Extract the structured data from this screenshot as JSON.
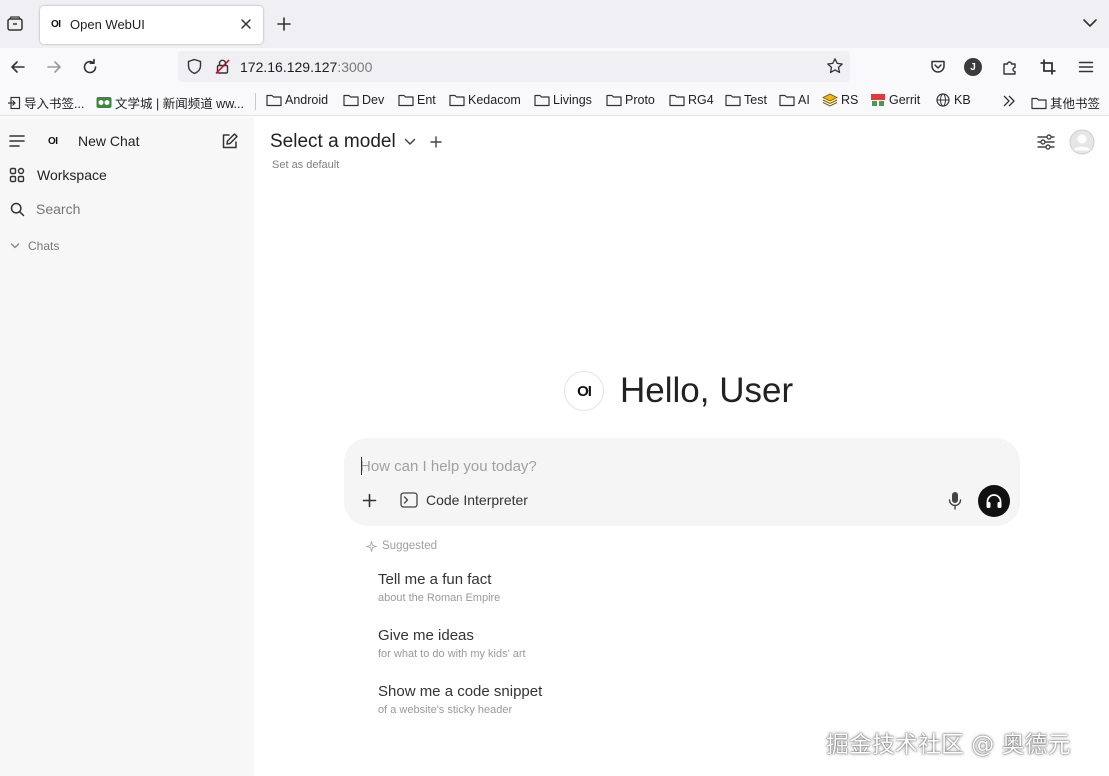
{
  "browser": {
    "tab_favicon": "OI",
    "tab_title": "Open WebUI",
    "url_host": "172.16.129.127",
    "url_port": ":3000",
    "profile_initial": "J",
    "bookmarks": [
      {
        "label": "导入书签..."
      },
      {
        "label": "文学城 | 新闻频道 ww..."
      },
      {
        "label": "Android"
      },
      {
        "label": "Dev"
      },
      {
        "label": "Ent"
      },
      {
        "label": "Kedacom"
      },
      {
        "label": "Livings"
      },
      {
        "label": "Proto"
      },
      {
        "label": "RG4"
      },
      {
        "label": "Test"
      },
      {
        "label": "AI"
      },
      {
        "label": "RS"
      },
      {
        "label": "Gerrit"
      },
      {
        "label": "KB"
      },
      {
        "label": "其他书签"
      }
    ]
  },
  "sidebar": {
    "logo": "OI",
    "new_chat": "New Chat",
    "workspace": "Workspace",
    "search_placeholder": "Search",
    "chats": "Chats"
  },
  "header": {
    "model_select": "Select a model",
    "set_default": "Set as default"
  },
  "hero": {
    "logo": "OI",
    "greeting": "Hello, User"
  },
  "composer": {
    "placeholder": "How can I help you today?",
    "value": "",
    "code_interpreter": "Code Interpreter"
  },
  "suggestions": {
    "heading": "Suggested",
    "items": [
      {
        "title": "Tell me a fun fact",
        "subtitle": "about the Roman Empire"
      },
      {
        "title": "Give me ideas",
        "subtitle": "for what to do with my kids' art"
      },
      {
        "title": "Show me a code snippet",
        "subtitle": "of a website's sticky header"
      }
    ]
  },
  "watermark": "掘金技术社区 @ 奥德元",
  "colors": {
    "accent_dark": "#111111",
    "sidebar_bg": "#f7f7f7",
    "composer_bg": "#f5f5f5"
  }
}
